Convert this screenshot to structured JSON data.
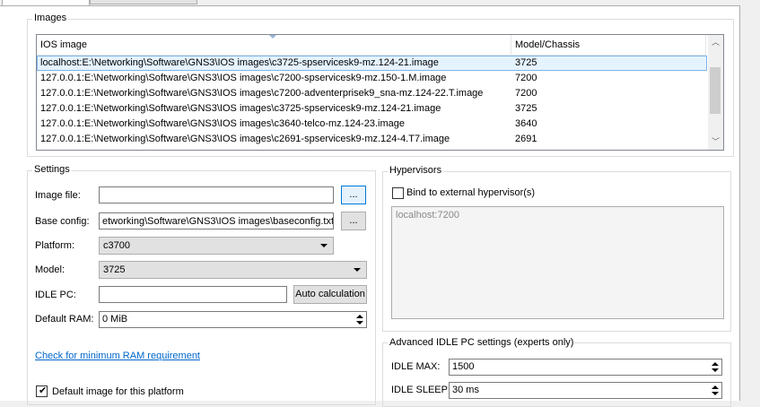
{
  "groups": {
    "images_title": "Images",
    "settings_title": "Settings",
    "hypervisors_title": "Hypervisors",
    "idle_title": "Advanced IDLE PC settings (experts only)"
  },
  "images_table": {
    "columns": [
      "IOS image",
      "Model/Chassis"
    ],
    "selected_index": 0,
    "rows": [
      {
        "image": "localhost:E:\\Networking\\Software\\GNS3\\IOS images\\c3725-spservicesk9-mz.124-21.image",
        "model": "3725"
      },
      {
        "image": "127.0.0.1:E:\\Networking\\Software\\GNS3\\IOS images\\c7200-spservicesk9-mz.150-1.M.image",
        "model": "7200"
      },
      {
        "image": "127.0.0.1:E:\\Networking\\Software\\GNS3\\IOS images\\c7200-adventerprisek9_sna-mz.124-22.T.image",
        "model": "7200"
      },
      {
        "image": "127.0.0.1:E:\\Networking\\Software\\GNS3\\IOS images\\c3725-spservicesk9-mz.124-21.image",
        "model": "3725"
      },
      {
        "image": "127.0.0.1:E:\\Networking\\Software\\GNS3\\IOS images\\c3640-telco-mz.124-23.image",
        "model": "3640"
      },
      {
        "image": "127.0.0.1:E:\\Networking\\Software\\GNS3\\IOS images\\c2691-spservicesk9-mz.124-4.T7.image",
        "model": "2691"
      }
    ]
  },
  "settings": {
    "image_file_label": "Image file:",
    "image_file_value": "",
    "browse_label": "...",
    "base_config_label": "Base config:",
    "base_config_value": "etworking\\Software\\GNS3\\IOS images\\baseconfig.txt",
    "platform_label": "Platform:",
    "platform_value": "c3700",
    "model_label": "Model:",
    "model_value": "3725",
    "idle_pc_label": "IDLE PC:",
    "idle_pc_value": "",
    "auto_calc_label": "Auto calculation",
    "default_ram_label": "Default RAM:",
    "default_ram_value": "0 MiB",
    "check_ram_link": "Check for minimum RAM requirement",
    "default_image_label": "Default image for this platform",
    "default_image_checked": true
  },
  "hypervisors": {
    "bind_label": "Bind to external hypervisor(s)",
    "bind_checked": false,
    "items": [
      "localhost:7200"
    ]
  },
  "idle": {
    "idle_max_label": "IDLE MAX:",
    "idle_max_value": "1500",
    "idle_sleep_label": "IDLE SLEEP:",
    "idle_sleep_value": "30 ms"
  }
}
